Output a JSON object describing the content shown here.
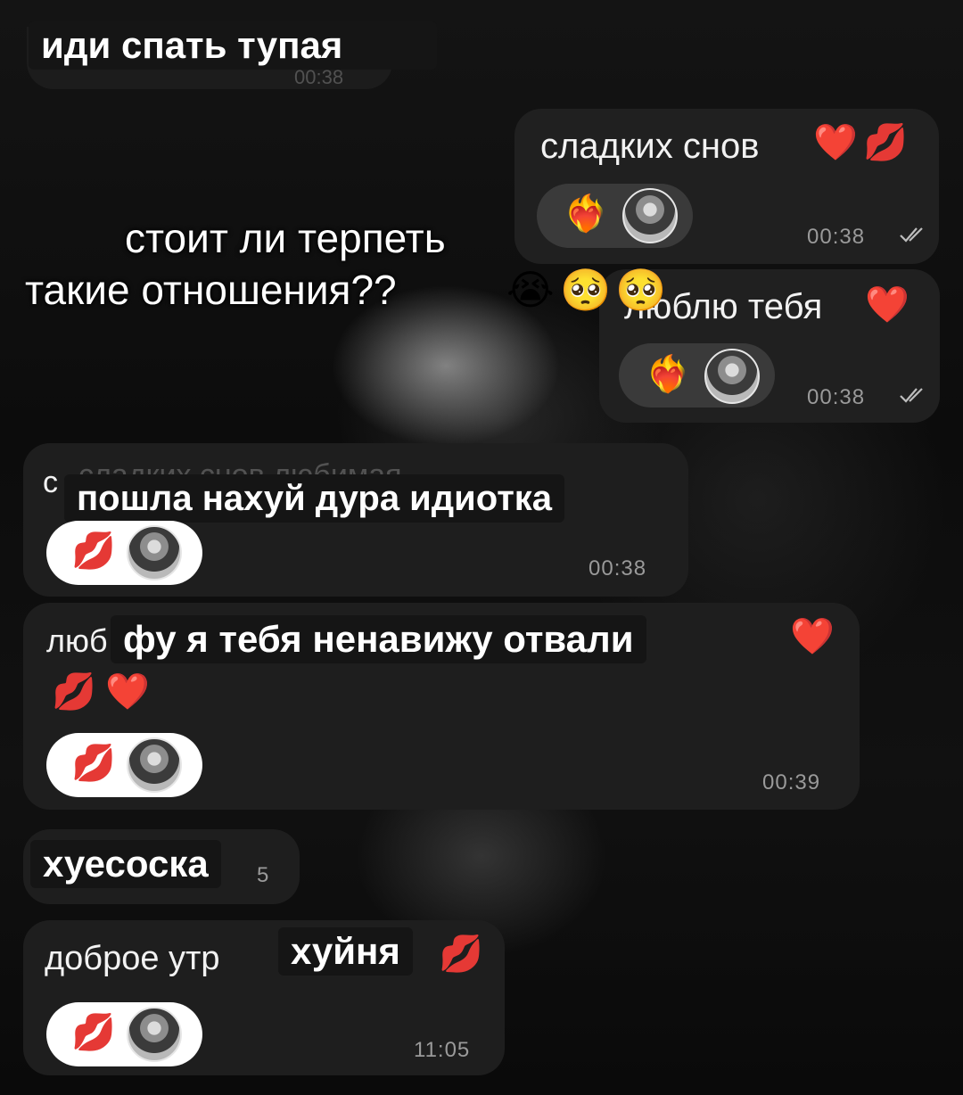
{
  "stickers": {
    "top": "иди спать тупая",
    "middle": "пошла нахуй дура идиотка",
    "hate": "фу я тебя ненавижу отвали",
    "insult": "хуесоска",
    "bottom": "хуйня"
  },
  "overlay_caption": [
    "стоит ли терпеть",
    "такие отношения??"
  ],
  "overlay_emoji": [
    "😭",
    "🥺",
    "🥺"
  ],
  "messages": [
    {
      "text": "сладких снов",
      "time": "00:38",
      "direction": "outgoing",
      "read": true
    },
    {
      "text": "люблю тебя",
      "time": "00:38",
      "direction": "outgoing",
      "read": true
    },
    {
      "text": "сладких снов любимая",
      "time": "00:38",
      "direction": "incoming"
    },
    {
      "text": "люб",
      "time": "00:39",
      "direction": "incoming"
    },
    {
      "text": "",
      "time": "",
      "direction": "incoming"
    },
    {
      "text": "доброе утро",
      "time": "11:05",
      "direction": "incoming"
    }
  ],
  "partial_text": {
    "msg3_prefix": "с",
    "msg4_prefix": "люб",
    "msg6_prefix": "доброе утр",
    "insult_suffix": "5",
    "top_ghost_time": "00:38"
  },
  "reaction_emoji": {
    "fire_heart": "❤️‍🔥",
    "kiss": "💋",
    "heart": "❤️"
  },
  "colors": {
    "bubble": "#202020",
    "accent_heart": "#e4112a",
    "time_text": "#9a9a9a"
  }
}
